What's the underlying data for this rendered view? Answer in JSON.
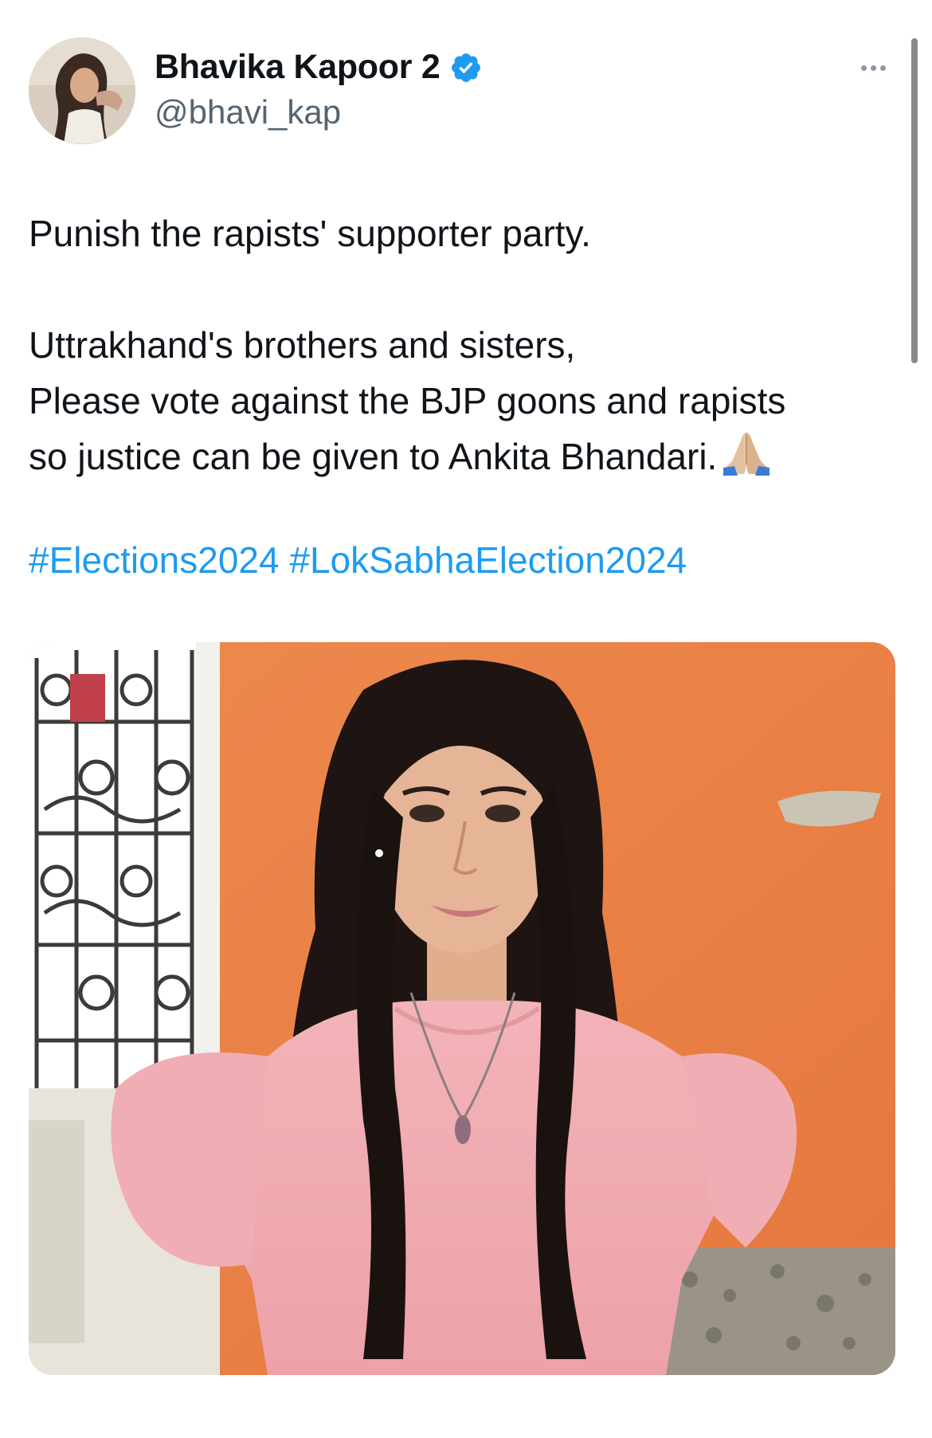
{
  "author": {
    "display_name": "Bhavika Kapoor 2",
    "handle": "@bhavi_kap",
    "verified": true,
    "verified_color": "#1d9bf0"
  },
  "tweet": {
    "line1": "Punish the rapists' supporter party.",
    "line2": "Uttrakhand's brothers and sisters,",
    "line3": "Please vote against the BJP goons and rapists",
    "line4": "so justice can be given to Ankita Bhandari.",
    "hashtags": [
      "#Elections2024",
      "#LokSabhaElection2024"
    ],
    "hashtag_color": "#1d9bf0"
  },
  "icons": {
    "more": "more-options-icon",
    "verified": "verified-badge-icon",
    "emoji": "folded-hands-icon"
  }
}
